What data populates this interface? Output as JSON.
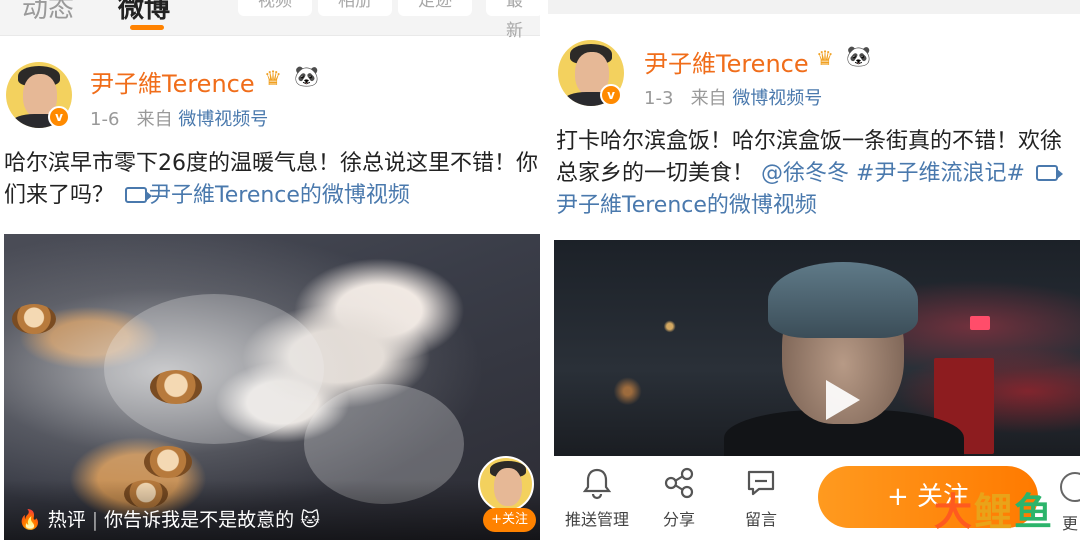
{
  "left": {
    "tabs": [
      {
        "label": "动态",
        "active": false
      },
      {
        "label": "微博",
        "active": true
      }
    ],
    "chips": [
      "视频",
      "相册",
      "足迹",
      "最新"
    ],
    "post": {
      "author": "尹子維Terence",
      "date": "1-6",
      "source_prefix": "来自",
      "source": "微博视频号",
      "text": "哈尔滨早市零下26度的温暖气息！徐总说这里不错！你们来了吗？",
      "video_link": "尹子維Terence的微博视频"
    },
    "video": {
      "hot_label": "热评",
      "hot_comment": "你告诉我是不是故意的",
      "follow_mini": "+关注"
    }
  },
  "right": {
    "post": {
      "author": "尹子維Terence",
      "date": "1-3",
      "source_prefix": "来自",
      "source": "微博视频号",
      "text_main": "打卡哈尔滨盒饭！哈尔滨盒饭一条街真的不错！欢徐总家乡的一切美食！",
      "mention": "@徐冬冬",
      "hashtag": "#尹子维流浪记#",
      "video_link": "尹子維Terence的微博视频"
    },
    "actions": [
      {
        "label": "推送管理",
        "icon": "bell-icon"
      },
      {
        "label": "分享",
        "icon": "share-icon"
      },
      {
        "label": "留言",
        "icon": "comment-icon"
      }
    ],
    "follow_button": "+ 关注",
    "more_label": "更"
  },
  "watermark": [
    "大",
    "鲤",
    "鱼"
  ],
  "colors": {
    "accent": "#ff8200",
    "name": "#f06d1a",
    "link": "#4a79ad"
  }
}
